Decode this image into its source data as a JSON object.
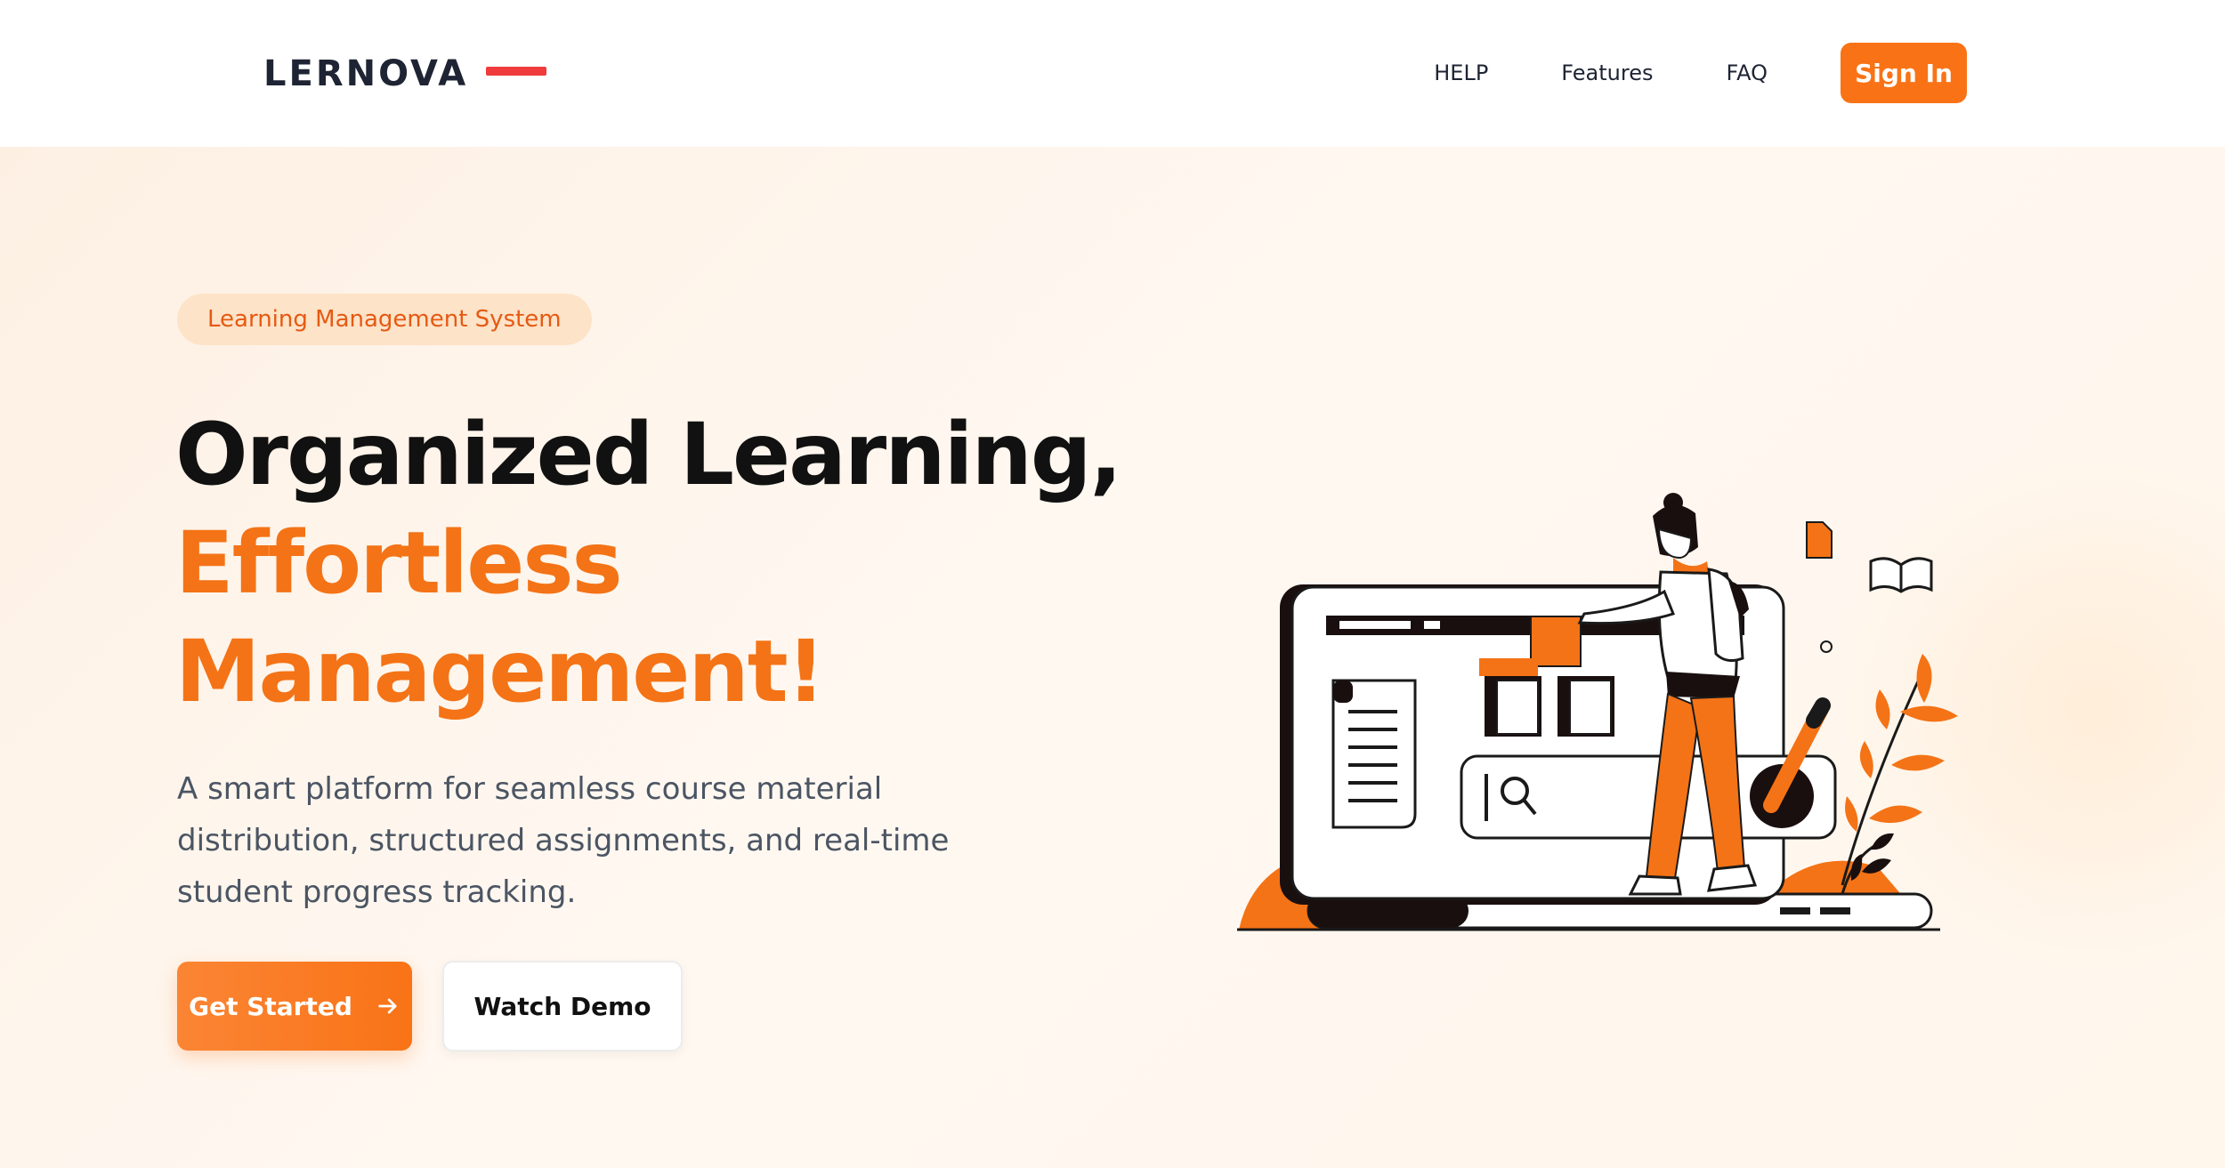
{
  "header": {
    "logo_text": "LERNOVA",
    "nav": [
      "HELP",
      "Features",
      "FAQ"
    ],
    "signin_label": "Sign In"
  },
  "hero": {
    "badge": "Learning Management System",
    "headline_line1": "Organized Learning,",
    "headline_line2": "Effortless",
    "headline_line3": "Management!",
    "description": "A smart platform for seamless course material distribution, structured assignments, and real-time student progress tracking.",
    "primary_cta": "Get Started",
    "secondary_cta": "Watch Demo"
  },
  "icons": {
    "cta_arrow": "arrow-right-icon",
    "illustration": "student-laptop-illustration"
  },
  "colors": {
    "accent": "#f97316",
    "logo_bar": "#ef3b3b",
    "text_dark": "#111111",
    "badge_bg": "#fde3c8"
  }
}
